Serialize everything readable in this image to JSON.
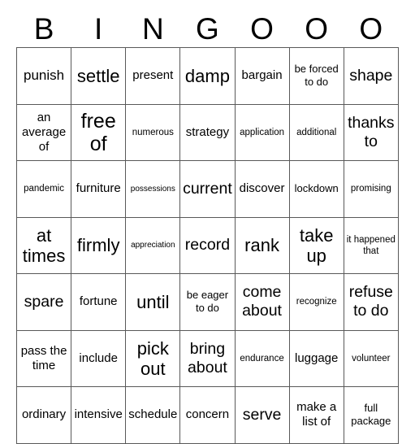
{
  "card": {
    "headers": [
      "B",
      "I",
      "N",
      "G",
      "O",
      "O",
      "O"
    ],
    "rows": [
      [
        {
          "text": "punish",
          "size": "l"
        },
        {
          "text": "settle",
          "size": "2xl"
        },
        {
          "text": "present",
          "size": "m"
        },
        {
          "text": "damp",
          "size": "2xl"
        },
        {
          "text": "bargain",
          "size": "m"
        },
        {
          "text": "be forced to do",
          "size": "s"
        },
        {
          "text": "shape",
          "size": "xl"
        }
      ],
      [
        {
          "text": "an average of",
          "size": "m"
        },
        {
          "text": "free of",
          "size": "3xl"
        },
        {
          "text": "numerous",
          "size": "xs"
        },
        {
          "text": "strategy",
          "size": "m"
        },
        {
          "text": "application",
          "size": "xs"
        },
        {
          "text": "additional",
          "size": "xs"
        },
        {
          "text": "thanks to",
          "size": "xl"
        }
      ],
      [
        {
          "text": "pandemic",
          "size": "xs"
        },
        {
          "text": "furniture",
          "size": "m"
        },
        {
          "text": "possessions",
          "size": "xxs"
        },
        {
          "text": "current",
          "size": "xl"
        },
        {
          "text": "discover",
          "size": "m"
        },
        {
          "text": "lockdown",
          "size": "s"
        },
        {
          "text": "promising",
          "size": "xs"
        }
      ],
      [
        {
          "text": "at times",
          "size": "2xl"
        },
        {
          "text": "firmly",
          "size": "2xl"
        },
        {
          "text": "appreciation",
          "size": "xxs"
        },
        {
          "text": "record",
          "size": "xl"
        },
        {
          "text": "rank",
          "size": "2xl"
        },
        {
          "text": "take up",
          "size": "2xl"
        },
        {
          "text": "it happened that",
          "size": "xs"
        }
      ],
      [
        {
          "text": "spare",
          "size": "xl"
        },
        {
          "text": "fortune",
          "size": "m"
        },
        {
          "text": "until",
          "size": "2xl"
        },
        {
          "text": "be eager to do",
          "size": "s"
        },
        {
          "text": "come about",
          "size": "xl"
        },
        {
          "text": "recognize",
          "size": "xs"
        },
        {
          "text": "refuse to do",
          "size": "xl"
        }
      ],
      [
        {
          "text": "pass the time",
          "size": "m"
        },
        {
          "text": "include",
          "size": "m"
        },
        {
          "text": "pick out",
          "size": "2xl"
        },
        {
          "text": "bring about",
          "size": "xl"
        },
        {
          "text": "endurance",
          "size": "xs"
        },
        {
          "text": "luggage",
          "size": "m"
        },
        {
          "text": "volunteer",
          "size": "xs"
        }
      ],
      [
        {
          "text": "ordinary",
          "size": "m"
        },
        {
          "text": "intensive",
          "size": "m"
        },
        {
          "text": "schedule",
          "size": "m"
        },
        {
          "text": "concern",
          "size": "m"
        },
        {
          "text": "serve",
          "size": "xl"
        },
        {
          "text": "make a list of",
          "size": "m"
        },
        {
          "text": "full package",
          "size": "s"
        }
      ]
    ]
  },
  "colors": {
    "grid_line": "#595959",
    "text": "#000000",
    "background": "#ffffff"
  }
}
